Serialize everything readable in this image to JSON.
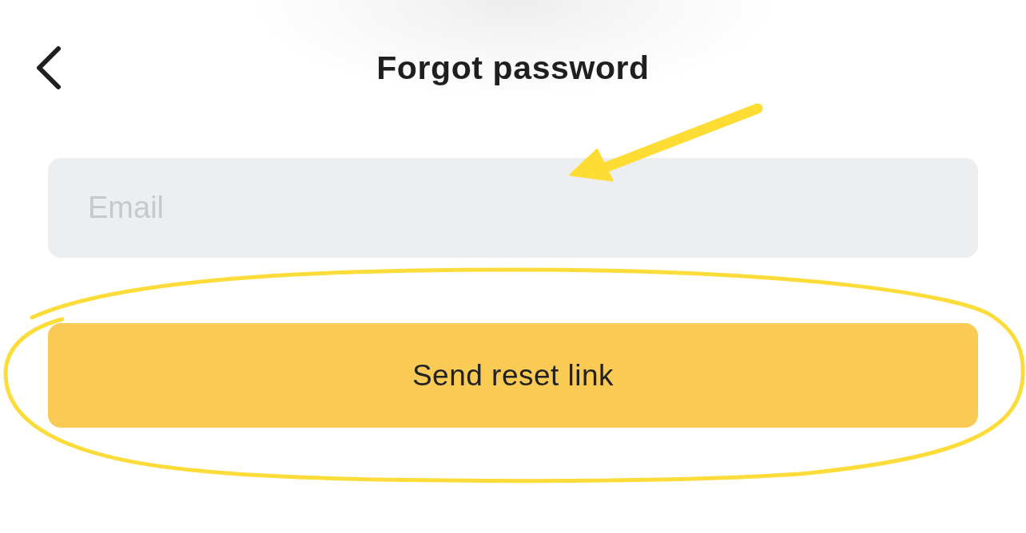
{
  "header": {
    "title": "Forgot password"
  },
  "email_field": {
    "placeholder": "Email"
  },
  "submit_button": {
    "label": "Send reset link"
  }
}
